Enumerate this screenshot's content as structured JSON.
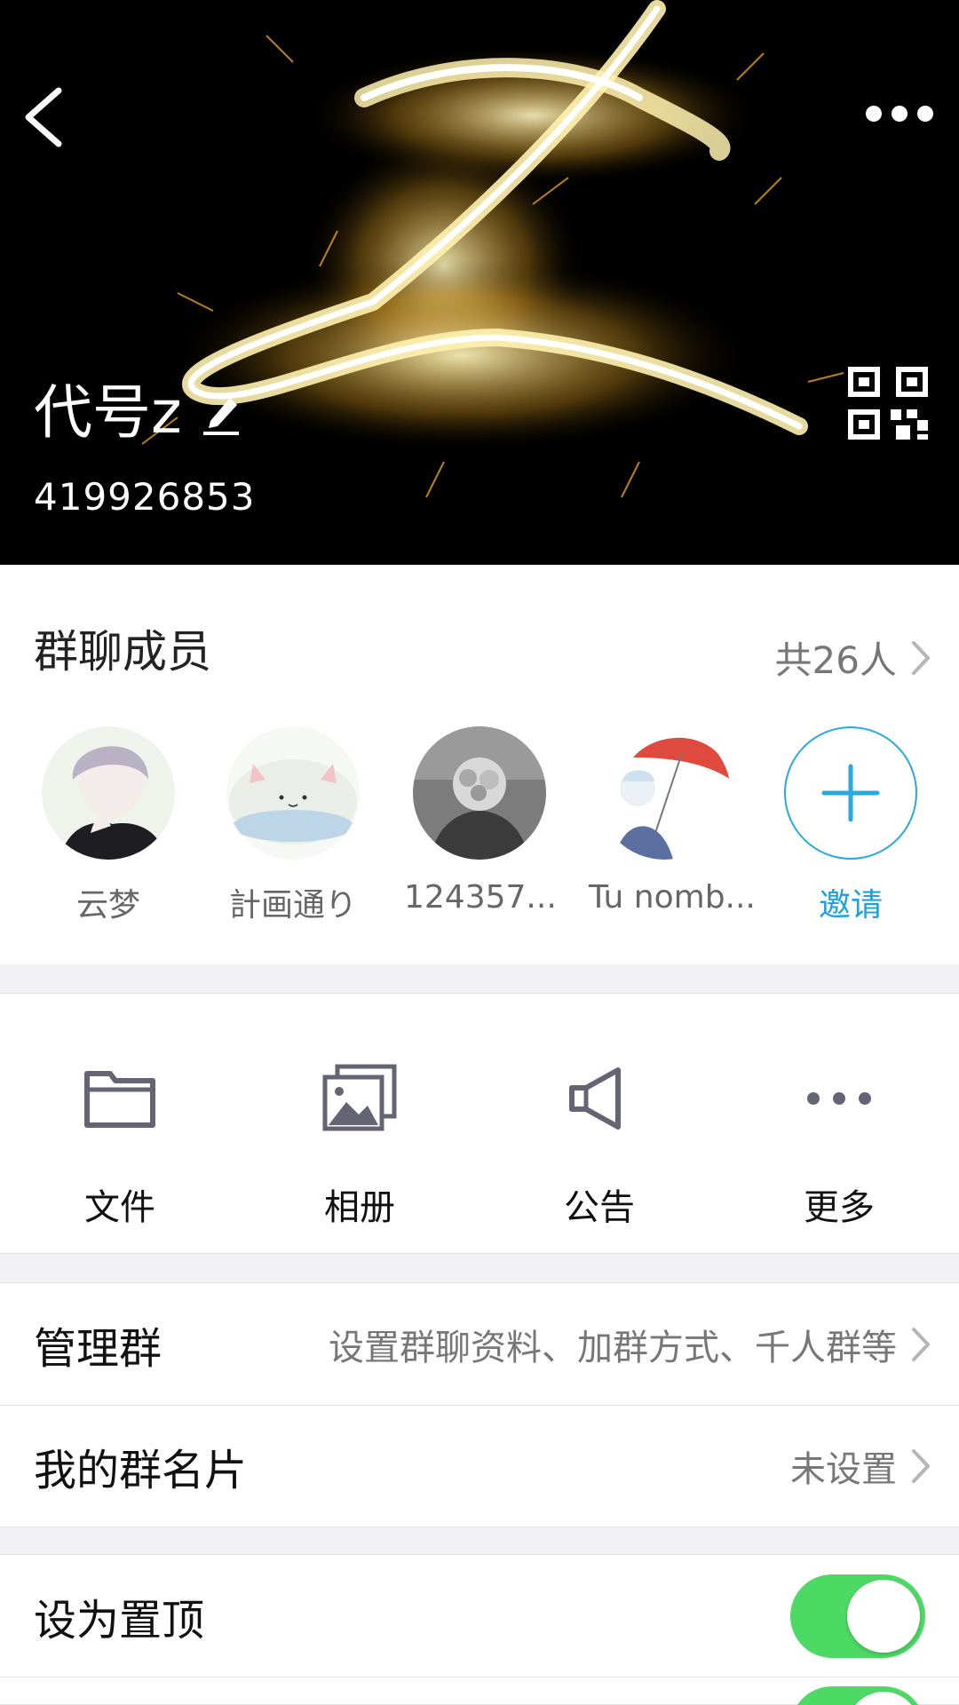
{
  "header": {
    "group_name": "代号z",
    "group_id": "419926853"
  },
  "members": {
    "title": "群聊成员",
    "count": "共26人",
    "list": [
      {
        "name": "云梦"
      },
      {
        "name": "計画通り"
      },
      {
        "name": "124357..."
      },
      {
        "name": "Tu nomb..."
      }
    ],
    "invite_label": "邀请"
  },
  "features": [
    {
      "label": "文件",
      "icon": "folder-icon"
    },
    {
      "label": "相册",
      "icon": "photo-album-icon"
    },
    {
      "label": "公告",
      "icon": "megaphone-icon"
    },
    {
      "label": "更多",
      "icon": "more-dots-icon"
    }
  ],
  "settings": {
    "manage": {
      "label": "管理群",
      "value": "设置群聊资料、加群方式、千人群等"
    },
    "card": {
      "label": "我的群名片",
      "value": "未设置"
    },
    "pin": {
      "label": "设为置顶",
      "on": true
    }
  },
  "colors": {
    "accent": "#1aa3e0",
    "toggle_on": "#4cd964",
    "banner_bg": "#000000"
  }
}
